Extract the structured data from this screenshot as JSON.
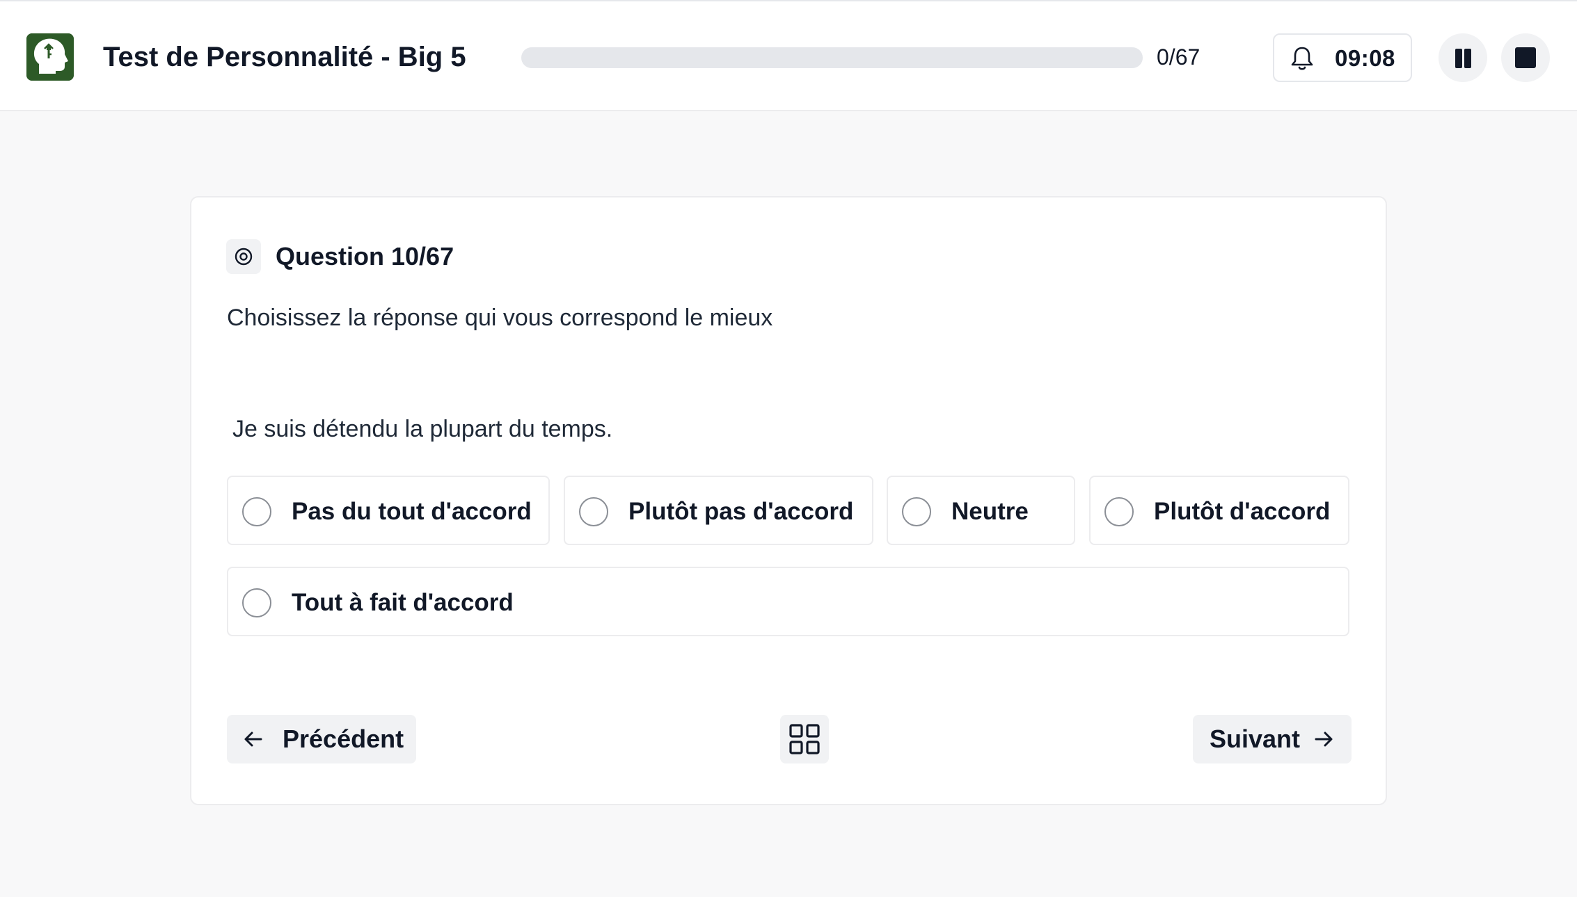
{
  "header": {
    "title": "Test de Personnalité - Big 5",
    "progress_text": "0/67",
    "progress_fraction": 0,
    "timer": "09:08",
    "logo_icon": "head-brain-icon",
    "bell_icon": "bell-icon",
    "pause_icon": "pause-icon",
    "stop_icon": "stop-icon"
  },
  "question": {
    "number_label": "Question 10/67",
    "icon": "target-icon",
    "instruction": "Choisissez la réponse qui vous correspond le mieux",
    "statement": "Je suis détendu la plupart du temps.",
    "options": [
      {
        "label": "Pas du tout d'accord",
        "selected": false
      },
      {
        "label": "Plutôt pas d'accord",
        "selected": false
      },
      {
        "label": "Neutre",
        "selected": false
      },
      {
        "label": "Plutôt d'accord",
        "selected": false
      },
      {
        "label": "Tout à fait d'accord",
        "selected": false
      }
    ]
  },
  "navigation": {
    "previous_label": "Précédent",
    "next_label": "Suivant",
    "grid_icon": "grid-icon",
    "previous_icon": "arrow-left-icon",
    "next_icon": "arrow-right-icon"
  },
  "colors": {
    "brand": "#2d5a27",
    "background": "#f8f8f9",
    "card": "#ffffff",
    "text": "#111827",
    "button_bg": "#f1f2f4",
    "border": "#ececee"
  }
}
